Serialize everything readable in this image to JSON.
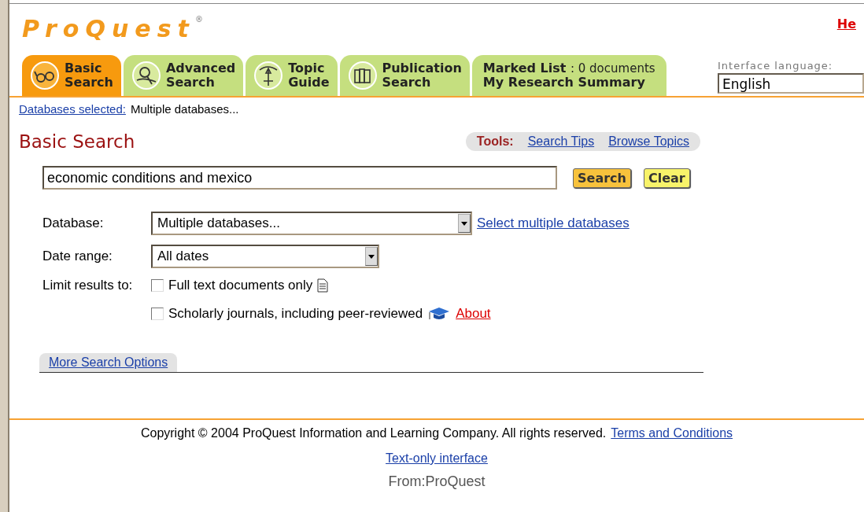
{
  "header": {
    "logo": "ProQuest",
    "logo_mark": "®",
    "help_link": "He"
  },
  "tabs": [
    {
      "kind": "search",
      "line1": "Basic",
      "line2": "Search",
      "selected": true
    },
    {
      "kind": "search",
      "line1": "Advanced",
      "line2": "Search",
      "selected": false
    },
    {
      "kind": "search",
      "line1": "Topic",
      "line2": "Guide",
      "selected": false
    },
    {
      "kind": "search",
      "line1": "Publication",
      "line2": "Search",
      "selected": false
    },
    {
      "kind": "list",
      "line1": "Marked List",
      "count": ": 0 documents",
      "line2": "My Research Summary",
      "selected": false
    }
  ],
  "interface_language": {
    "label": "Interface language:",
    "value": "English"
  },
  "databases_selected": {
    "link": "Databases selected:",
    "value": "Multiple databases..."
  },
  "page_title": "Basic Search",
  "tools": {
    "label": "Tools:",
    "links": [
      "Search Tips",
      "Browse Topics"
    ]
  },
  "search": {
    "value": "economic conditions and mexico",
    "buttons": [
      "Search",
      "Clear"
    ]
  },
  "database": {
    "label": "Database:",
    "value": "Multiple databases...",
    "link": "Select multiple databases"
  },
  "date_range": {
    "label": "Date range:",
    "value": "All dates"
  },
  "limits": {
    "label": "Limit results to:",
    "options": [
      {
        "kind": "fulltext",
        "label": "Full text documents only",
        "checked": false
      },
      {
        "kind": "scholarly",
        "label": "Scholarly journals, including peer-reviewed",
        "link": "About",
        "checked": false
      }
    ]
  },
  "more_options": "More Search Options",
  "footer": {
    "copyright": "Copyright © 2004 ProQuest Information and Learning Company. All rights reserved.",
    "terms": "Terms and Conditions",
    "text_only": "Text-only interface",
    "from_logo": "From:ProQuest"
  }
}
